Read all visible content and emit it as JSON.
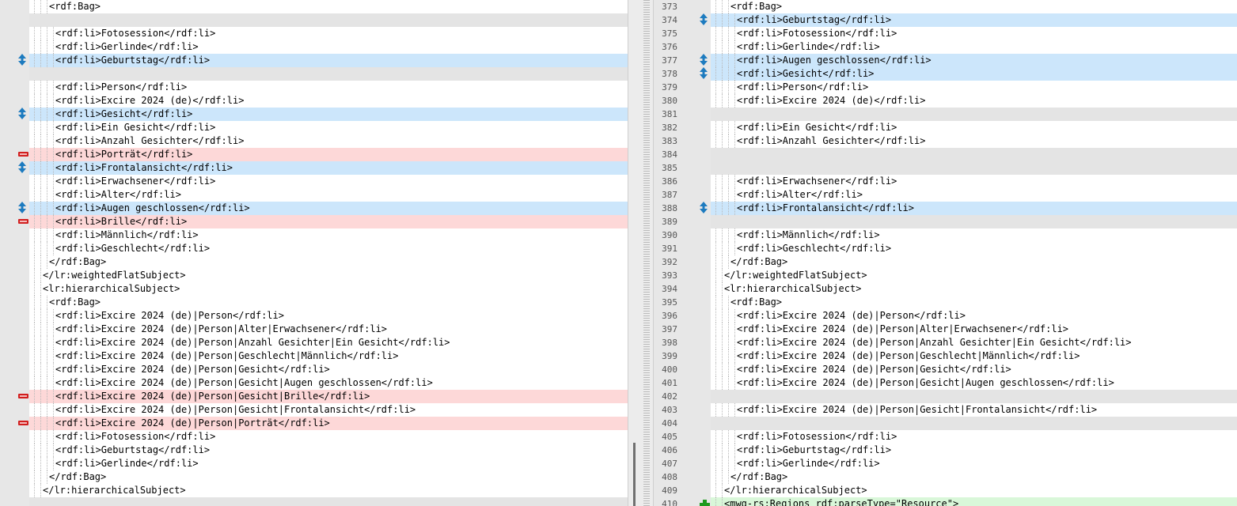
{
  "colors": {
    "changed": "#cce6fb",
    "removed": "#fdd8d8",
    "added": "#d9f7d9",
    "blank": "#e4e4e4",
    "changed_marker": "#1d7bbf",
    "removed_marker": "#d21f1f",
    "added_marker": "#1e9a1e"
  },
  "left_pane": {
    "lines": [
      {
        "indent": 3,
        "text": "<rdf:Bag>",
        "status": "normal"
      },
      {
        "indent": 0,
        "text": "",
        "status": "blank"
      },
      {
        "indent": 4,
        "text": "<rdf:li>Fotosession</rdf:li>",
        "status": "normal"
      },
      {
        "indent": 4,
        "text": "<rdf:li>Gerlinde</rdf:li>",
        "status": "normal"
      },
      {
        "indent": 4,
        "text": "<rdf:li>Geburtstag</rdf:li>",
        "status": "changed",
        "marker": "move-arrows-icon"
      },
      {
        "indent": 0,
        "text": "",
        "status": "blank"
      },
      {
        "indent": 4,
        "text": "<rdf:li>Person</rdf:li>",
        "status": "normal"
      },
      {
        "indent": 4,
        "text": "<rdf:li>Excire 2024 (de)</rdf:li>",
        "status": "normal"
      },
      {
        "indent": 4,
        "text": "<rdf:li>Gesicht</rdf:li>",
        "status": "changed",
        "marker": "move-arrows-icon"
      },
      {
        "indent": 4,
        "text": "<rdf:li>Ein Gesicht</rdf:li>",
        "status": "normal"
      },
      {
        "indent": 4,
        "text": "<rdf:li>Anzahl Gesichter</rdf:li>",
        "status": "normal"
      },
      {
        "indent": 4,
        "text": "<rdf:li>Porträt</rdf:li>",
        "status": "removed",
        "marker": "minus-icon"
      },
      {
        "indent": 4,
        "text": "<rdf:li>Frontalansicht</rdf:li>",
        "status": "changed",
        "marker": "move-arrows-icon"
      },
      {
        "indent": 4,
        "text": "<rdf:li>Erwachsener</rdf:li>",
        "status": "normal"
      },
      {
        "indent": 4,
        "text": "<rdf:li>Alter</rdf:li>",
        "status": "normal"
      },
      {
        "indent": 4,
        "text": "<rdf:li>Augen geschlossen</rdf:li>",
        "status": "changed",
        "marker": "move-arrows-icon"
      },
      {
        "indent": 4,
        "text": "<rdf:li>Brille</rdf:li>",
        "status": "removed",
        "marker": "minus-icon"
      },
      {
        "indent": 4,
        "text": "<rdf:li>Männlich</rdf:li>",
        "status": "normal"
      },
      {
        "indent": 4,
        "text": "<rdf:li>Geschlecht</rdf:li>",
        "status": "normal"
      },
      {
        "indent": 3,
        "text": "</rdf:Bag>",
        "status": "normal"
      },
      {
        "indent": 2,
        "text": "</lr:weightedFlatSubject>",
        "status": "normal"
      },
      {
        "indent": 2,
        "text": "<lr:hierarchicalSubject>",
        "status": "normal"
      },
      {
        "indent": 3,
        "text": "<rdf:Bag>",
        "status": "normal"
      },
      {
        "indent": 4,
        "text": "<rdf:li>Excire 2024 (de)|Person</rdf:li>",
        "status": "normal"
      },
      {
        "indent": 4,
        "text": "<rdf:li>Excire 2024 (de)|Person|Alter|Erwachsener</rdf:li>",
        "status": "normal"
      },
      {
        "indent": 4,
        "text": "<rdf:li>Excire 2024 (de)|Person|Anzahl Gesichter|Ein Gesicht</rdf:li>",
        "status": "normal"
      },
      {
        "indent": 4,
        "text": "<rdf:li>Excire 2024 (de)|Person|Geschlecht|Männlich</rdf:li>",
        "status": "normal"
      },
      {
        "indent": 4,
        "text": "<rdf:li>Excire 2024 (de)|Person|Gesicht</rdf:li>",
        "status": "normal"
      },
      {
        "indent": 4,
        "text": "<rdf:li>Excire 2024 (de)|Person|Gesicht|Augen geschlossen</rdf:li>",
        "status": "normal"
      },
      {
        "indent": 4,
        "text": "<rdf:li>Excire 2024 (de)|Person|Gesicht|Brille</rdf:li>",
        "status": "removed",
        "marker": "minus-icon"
      },
      {
        "indent": 4,
        "text": "<rdf:li>Excire 2024 (de)|Person|Gesicht|Frontalansicht</rdf:li>",
        "status": "normal"
      },
      {
        "indent": 4,
        "text": "<rdf:li>Excire 2024 (de)|Person|Porträt</rdf:li>",
        "status": "removed",
        "marker": "minus-icon"
      },
      {
        "indent": 4,
        "text": "<rdf:li>Fotosession</rdf:li>",
        "status": "normal"
      },
      {
        "indent": 4,
        "text": "<rdf:li>Geburtstag</rdf:li>",
        "status": "normal"
      },
      {
        "indent": 4,
        "text": "<rdf:li>Gerlinde</rdf:li>",
        "status": "normal"
      },
      {
        "indent": 3,
        "text": "</rdf:Bag>",
        "status": "normal"
      },
      {
        "indent": 2,
        "text": "</lr:hierarchicalSubject>",
        "status": "normal"
      },
      {
        "indent": 0,
        "text": "",
        "status": "blank"
      }
    ]
  },
  "right_pane": {
    "lines": [
      {
        "num": "373",
        "indent": 3,
        "text": "<rdf:Bag>",
        "status": "normal"
      },
      {
        "num": "374",
        "indent": 4,
        "text": "<rdf:li>Geburtstag</rdf:li>",
        "status": "changed",
        "marker": "move-arrows-icon"
      },
      {
        "num": "375",
        "indent": 4,
        "text": "<rdf:li>Fotosession</rdf:li>",
        "status": "normal"
      },
      {
        "num": "376",
        "indent": 4,
        "text": "<rdf:li>Gerlinde</rdf:li>",
        "status": "normal"
      },
      {
        "num": "377",
        "indent": 4,
        "text": "<rdf:li>Augen geschlossen</rdf:li>",
        "status": "changed",
        "marker": "move-arrows-icon"
      },
      {
        "num": "378",
        "indent": 4,
        "text": "<rdf:li>Gesicht</rdf:li>",
        "status": "changed",
        "marker": "move-arrows-icon"
      },
      {
        "num": "379",
        "indent": 4,
        "text": "<rdf:li>Person</rdf:li>",
        "status": "normal"
      },
      {
        "num": "380",
        "indent": 4,
        "text": "<rdf:li>Excire 2024 (de)</rdf:li>",
        "status": "normal"
      },
      {
        "num": "381",
        "indent": 0,
        "text": "",
        "status": "blank"
      },
      {
        "num": "382",
        "indent": 4,
        "text": "<rdf:li>Ein Gesicht</rdf:li>",
        "status": "normal"
      },
      {
        "num": "383",
        "indent": 4,
        "text": "<rdf:li>Anzahl Gesichter</rdf:li>",
        "status": "normal"
      },
      {
        "num": "384",
        "indent": 0,
        "text": "",
        "status": "blank"
      },
      {
        "num": "385",
        "indent": 0,
        "text": "",
        "status": "blank"
      },
      {
        "num": "386",
        "indent": 4,
        "text": "<rdf:li>Erwachsener</rdf:li>",
        "status": "normal"
      },
      {
        "num": "387",
        "indent": 4,
        "text": "<rdf:li>Alter</rdf:li>",
        "status": "normal"
      },
      {
        "num": "388",
        "indent": 4,
        "text": "<rdf:li>Frontalansicht</rdf:li>",
        "status": "changed",
        "marker": "move-arrows-icon"
      },
      {
        "num": "389",
        "indent": 0,
        "text": "",
        "status": "blank"
      },
      {
        "num": "390",
        "indent": 4,
        "text": "<rdf:li>Männlich</rdf:li>",
        "status": "normal"
      },
      {
        "num": "391",
        "indent": 4,
        "text": "<rdf:li>Geschlecht</rdf:li>",
        "status": "normal"
      },
      {
        "num": "392",
        "indent": 3,
        "text": "</rdf:Bag>",
        "status": "normal"
      },
      {
        "num": "393",
        "indent": 2,
        "text": "</lr:weightedFlatSubject>",
        "status": "normal"
      },
      {
        "num": "394",
        "indent": 2,
        "text": "<lr:hierarchicalSubject>",
        "status": "normal"
      },
      {
        "num": "395",
        "indent": 3,
        "text": "<rdf:Bag>",
        "status": "normal"
      },
      {
        "num": "396",
        "indent": 4,
        "text": "<rdf:li>Excire 2024 (de)|Person</rdf:li>",
        "status": "normal"
      },
      {
        "num": "397",
        "indent": 4,
        "text": "<rdf:li>Excire 2024 (de)|Person|Alter|Erwachsener</rdf:li>",
        "status": "normal"
      },
      {
        "num": "398",
        "indent": 4,
        "text": "<rdf:li>Excire 2024 (de)|Person|Anzahl Gesichter|Ein Gesicht</rdf:li>",
        "status": "normal"
      },
      {
        "num": "399",
        "indent": 4,
        "text": "<rdf:li>Excire 2024 (de)|Person|Geschlecht|Männlich</rdf:li>",
        "status": "normal"
      },
      {
        "num": "400",
        "indent": 4,
        "text": "<rdf:li>Excire 2024 (de)|Person|Gesicht</rdf:li>",
        "status": "normal"
      },
      {
        "num": "401",
        "indent": 4,
        "text": "<rdf:li>Excire 2024 (de)|Person|Gesicht|Augen geschlossen</rdf:li>",
        "status": "normal"
      },
      {
        "num": "402",
        "indent": 0,
        "text": "",
        "status": "blank"
      },
      {
        "num": "403",
        "indent": 4,
        "text": "<rdf:li>Excire 2024 (de)|Person|Gesicht|Frontalansicht</rdf:li>",
        "status": "normal"
      },
      {
        "num": "404",
        "indent": 0,
        "text": "",
        "status": "blank"
      },
      {
        "num": "405",
        "indent": 4,
        "text": "<rdf:li>Fotosession</rdf:li>",
        "status": "normal"
      },
      {
        "num": "406",
        "indent": 4,
        "text": "<rdf:li>Geburtstag</rdf:li>",
        "status": "normal"
      },
      {
        "num": "407",
        "indent": 4,
        "text": "<rdf:li>Gerlinde</rdf:li>",
        "status": "normal"
      },
      {
        "num": "408",
        "indent": 3,
        "text": "</rdf:Bag>",
        "status": "normal"
      },
      {
        "num": "409",
        "indent": 2,
        "text": "</lr:hierarchicalSubject>",
        "status": "normal"
      },
      {
        "num": "410",
        "indent": 2,
        "text": "<mwg-rs:Regions rdf:parseType=\"Resource\">",
        "status": "added",
        "marker": "plus-icon"
      }
    ]
  }
}
